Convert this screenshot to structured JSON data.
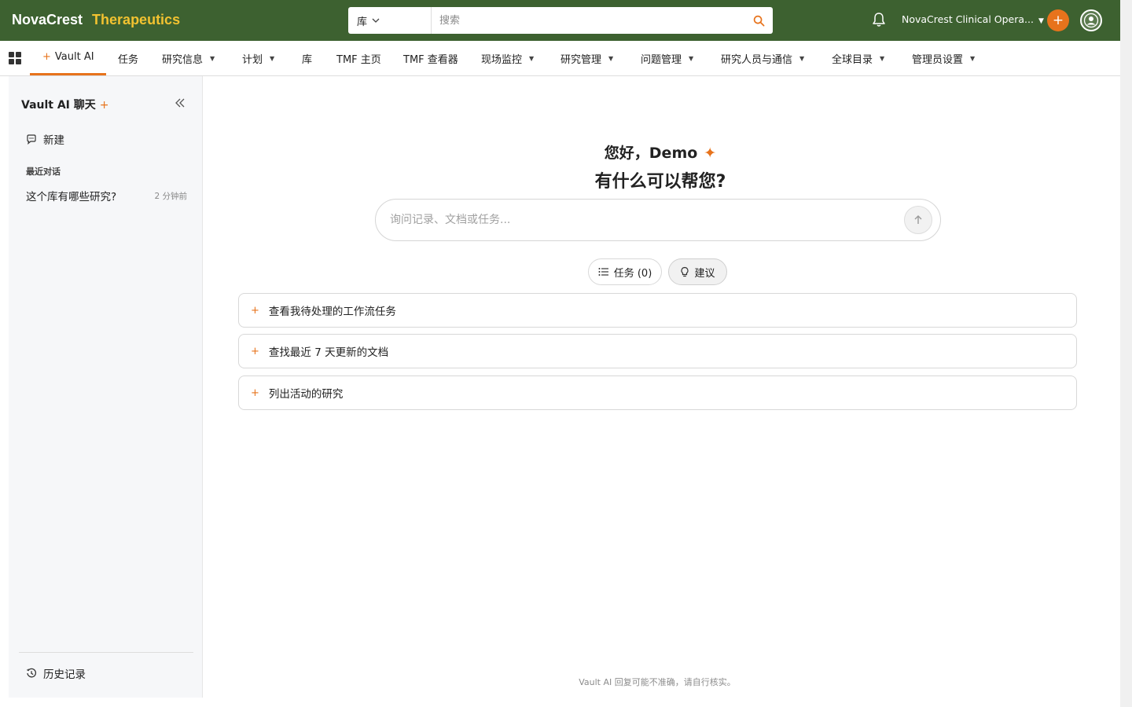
{
  "header": {
    "brand_primary": "NovaCrest",
    "brand_secondary": "Therapeutics",
    "search_scope": "库",
    "search_placeholder": "搜索",
    "account_name": "NovaCrest Clinical Opera...",
    "brand_color": "#3d6130",
    "accent_color": "#e7731c"
  },
  "nav": {
    "items": [
      {
        "label": "Vault AI",
        "active": true
      },
      {
        "label": "任务"
      },
      {
        "label": "研究信息",
        "dropdown": true
      },
      {
        "label": "计划",
        "dropdown": true
      },
      {
        "label": "库"
      },
      {
        "label": "TMF 主页"
      },
      {
        "label": "TMF 查看器"
      },
      {
        "label": "现场监控",
        "dropdown": true
      },
      {
        "label": "研究管理",
        "dropdown": true
      },
      {
        "label": "问题管理",
        "dropdown": true
      },
      {
        "label": "研究人员与通信",
        "dropdown": true
      },
      {
        "label": "全球目录",
        "dropdown": true
      },
      {
        "label": "管理员设置",
        "dropdown": true
      }
    ]
  },
  "sidebar": {
    "title": "Vault AI 聊天",
    "new_label": "新建",
    "recent_label": "最近对话",
    "conversations": [
      {
        "title": "这个库有哪些研究?",
        "time": "2 分钟前"
      }
    ],
    "history_label": "历史记录"
  },
  "main": {
    "greeting": "您好，Demo",
    "question": "有什么可以帮您?",
    "input_placeholder": "询问记录、文档或任务...",
    "tasks_label": "任务 (0)",
    "suggest_label": "建议",
    "suggestions": [
      "查看我待处理的工作流任务",
      "查找最近 7 天更新的文档",
      "列出活动的研究"
    ],
    "disclaimer": "Vault AI 回复可能不准确，请自行核实。"
  }
}
